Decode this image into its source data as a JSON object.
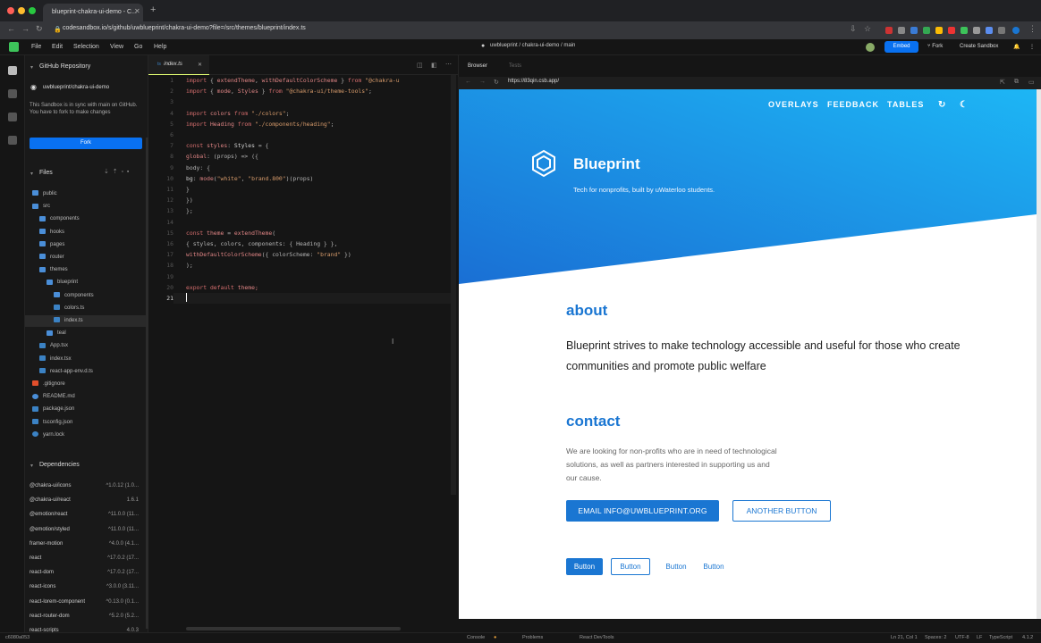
{
  "browser": {
    "tab_title": "blueprint-chakra-ui-demo - C...",
    "url": "codesandbox.io/s/github/uwblueprint/chakra-ui-demo?file=/src/themes/blueprint/index.ts"
  },
  "header": {
    "menu": [
      "File",
      "Edit",
      "Selection",
      "View",
      "Go",
      "Help"
    ],
    "repo": "uwblueprint / chakra-ui-demo / main",
    "embed": "Embed",
    "fork": "Fork",
    "create": "Create Sandbox"
  },
  "sidebar": {
    "github_title": "GitHub Repository",
    "repo_name": "uwblueprint/chakra-ui-demo",
    "sync_text": "This Sandbox is in sync with main on GitHub. You have to fork to make changes",
    "fork_label": "Fork",
    "files_title": "Files",
    "files": [
      {
        "name": "public",
        "kind": "folder"
      },
      {
        "name": "src",
        "kind": "folder"
      },
      {
        "name": "components",
        "kind": "folder"
      },
      {
        "name": "hooks",
        "kind": "folder"
      },
      {
        "name": "pages",
        "kind": "folder"
      },
      {
        "name": "router",
        "kind": "folder"
      },
      {
        "name": "themes",
        "kind": "folder"
      },
      {
        "name": "blueprint",
        "kind": "folder"
      },
      {
        "name": "components",
        "kind": "folder"
      },
      {
        "name": "colors.ts",
        "kind": "ts"
      },
      {
        "name": "index.ts",
        "kind": "ts"
      },
      {
        "name": "teal",
        "kind": "folder"
      },
      {
        "name": "App.tsx",
        "kind": "ts"
      },
      {
        "name": "index.tsx",
        "kind": "ts"
      },
      {
        "name": "react-app-env.d.ts",
        "kind": "ts"
      },
      {
        "name": ".gitignore",
        "kind": "git"
      },
      {
        "name": "README.md",
        "kind": "info"
      },
      {
        "name": "package.json",
        "kind": "json"
      },
      {
        "name": "tsconfig.json",
        "kind": "json"
      },
      {
        "name": "yarn.lock",
        "kind": "yarn"
      }
    ],
    "deps_title": "Dependencies",
    "deps": [
      {
        "name": "@chakra-ui/icons",
        "ver": "^1.0.12 (1.0..."
      },
      {
        "name": "@chakra-ui/react",
        "ver": "1.6.1"
      },
      {
        "name": "@emotion/react",
        "ver": "^11.0.0 (11..."
      },
      {
        "name": "@emotion/styled",
        "ver": "^11.0.0 (11..."
      },
      {
        "name": "framer-motion",
        "ver": "^4.0.0 (4.1..."
      },
      {
        "name": "react",
        "ver": "^17.0.2 (17..."
      },
      {
        "name": "react-dom",
        "ver": "^17.0.2 (17..."
      },
      {
        "name": "react-icons",
        "ver": "^3.0.0 (3.11..."
      },
      {
        "name": "react-lorem-component",
        "ver": "^0.13.0 (0.1..."
      },
      {
        "name": "react-router-dom",
        "ver": "^5.2.0 (5.2..."
      },
      {
        "name": "react-scripts",
        "ver": "4.0.3"
      }
    ]
  },
  "editor": {
    "tab": "index.ts",
    "lines": [
      [
        [
          "import",
          "kw"
        ],
        [
          " { ",
          "pl"
        ],
        [
          "extendTheme",
          "fn"
        ],
        [
          ", ",
          "pl"
        ],
        [
          "withDefaultColorScheme",
          "fn"
        ],
        [
          " } ",
          "pl"
        ],
        [
          "from",
          "kw"
        ],
        [
          " \"@chakra-u",
          "str"
        ]
      ],
      [
        [
          "import",
          "kw"
        ],
        [
          " { ",
          "pl"
        ],
        [
          "mode",
          "fn"
        ],
        [
          ", ",
          "pl"
        ],
        [
          "Styles",
          "fn"
        ],
        [
          " } ",
          "pl"
        ],
        [
          "from",
          "kw"
        ],
        [
          " \"@chakra-ui/theme-tools\"",
          "str"
        ],
        [
          ";",
          "pl"
        ]
      ],
      [],
      [
        [
          "import",
          "kw"
        ],
        [
          " colors ",
          "fn"
        ],
        [
          "from",
          "kw"
        ],
        [
          " \"./colors\"",
          "str"
        ],
        [
          ";",
          "pl"
        ]
      ],
      [
        [
          "import",
          "kw"
        ],
        [
          " Heading ",
          "fn"
        ],
        [
          "from",
          "kw"
        ],
        [
          " \"./components/heading\"",
          "str"
        ],
        [
          ";",
          "pl"
        ]
      ],
      [],
      [
        [
          "const",
          "kw"
        ],
        [
          " styles",
          "fn"
        ],
        [
          ": ",
          "pl"
        ],
        [
          "Styles",
          "id"
        ],
        [
          " = {",
          "pl"
        ]
      ],
      [
        [
          "  global",
          "fn"
        ],
        [
          ": (props) => ({",
          "pl"
        ]
      ],
      [
        [
          "    body",
          "pl"
        ],
        [
          ": {",
          "pl"
        ]
      ],
      [
        [
          "      bg",
          "id"
        ],
        [
          ": ",
          "pl"
        ],
        [
          "mode",
          "fn"
        ],
        [
          "(",
          "pl"
        ],
        [
          "\"white\"",
          "str"
        ],
        [
          ", ",
          "pl"
        ],
        [
          "\"brand.800\"",
          "str"
        ],
        [
          ")(props)",
          "pl"
        ]
      ],
      [
        [
          "    }",
          "pl"
        ]
      ],
      [
        [
          "  })",
          "pl"
        ]
      ],
      [
        [
          "};",
          "pl"
        ]
      ],
      [],
      [
        [
          "const",
          "kw"
        ],
        [
          " theme ",
          "fn"
        ],
        [
          "= ",
          "pl"
        ],
        [
          "extendTheme",
          "fn"
        ],
        [
          "(",
          "pl"
        ]
      ],
      [
        [
          "  { styles, colors, components: { Heading } },",
          "pl"
        ]
      ],
      [
        [
          "  withDefaultColorScheme",
          "fn"
        ],
        [
          "({ colorScheme: ",
          "pl"
        ],
        [
          "\"brand\"",
          "str"
        ],
        [
          " })",
          "pl"
        ]
      ],
      [
        [
          ");",
          "pl"
        ]
      ],
      [],
      [
        [
          "export",
          "kw"
        ],
        [
          " default",
          "kw"
        ],
        [
          " theme;",
          "fn"
        ]
      ],
      []
    ]
  },
  "preview": {
    "browser_tab": "Browser",
    "tests_tab": "Tests",
    "url": "https://83qin.csb.app/",
    "nav": [
      "OVERLAYS",
      "FEEDBACK",
      "TABLES"
    ],
    "brand": "Blueprint",
    "tagline": "Tech for nonprofits, built by uWaterloo students.",
    "about_heading": "about",
    "about_text": "Blueprint strives to make technology accessible and useful for those who create communities and promote public welfare",
    "contact_heading": "contact",
    "contact_text": "We are looking for non-profits who are in need of technological solutions, as well as partners interested in supporting us and our cause.",
    "email_button": "EMAIL INFO@UWBLUEPRINT.ORG",
    "another_button": "ANOTHER BUTTON",
    "buttons": [
      "Button",
      "Button",
      "Button",
      "Button"
    ]
  },
  "status": {
    "console": "Console",
    "problems": "Problems",
    "devtools": "React DevTools",
    "position": "Ln 21, Col 1",
    "spaces": "Spaces: 2",
    "encoding": "UTF-8",
    "eol": "LF",
    "lang": "TypeScript",
    "version": "4.1.2",
    "commit": "c6080a053"
  },
  "colors": {
    "brand": "#1a76d2",
    "gradient_start": "#1a6fd4",
    "gradient_end": "#1db6f5",
    "accent": "#0971f1"
  }
}
